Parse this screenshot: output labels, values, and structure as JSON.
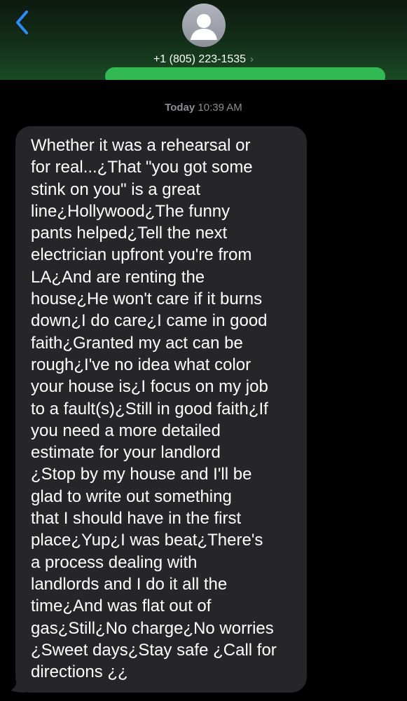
{
  "header": {
    "contact": "+1 (805) 223-1535",
    "chevron": "›",
    "back_icon": "chevron-left-icon",
    "avatar_icon": "person-silhouette-icon",
    "accent_color": "#2f8cff",
    "header_tint": "#1b4b24"
  },
  "timestamp": {
    "day": "Today",
    "time": "10:39 AM"
  },
  "message": {
    "bubble_color": "#262629",
    "lines": [
      "Whether it was a rehearsal or",
      "for real...¿That \"you got some",
      "stink on you\" is a great",
      "line¿Hollywood¿The funny",
      "pants helped¿Tell the next",
      "electrician upfront you're from",
      "LA¿And are renting the",
      "house¿He won't care if it burns",
      "down¿I do care¿I came in good",
      "faith¿Granted my act can be",
      "rough¿I've no idea what color",
      "your house is¿I focus on my job",
      "to a fault(s)¿Still in good faith¿If",
      "you need a more detailed",
      "estimate for your landlord",
      "¿Stop by my house and I'll be",
      "glad to write out something",
      "that I should have in the first",
      "place¿Yup¿I was beat¿There's",
      "a process dealing with",
      "landlords and I do it all the",
      "time¿And was flat out of",
      "gas¿Still¿No charge¿No worries",
      "¿Sweet days¿Stay safe ¿Call for",
      "directions ¿¿"
    ]
  }
}
